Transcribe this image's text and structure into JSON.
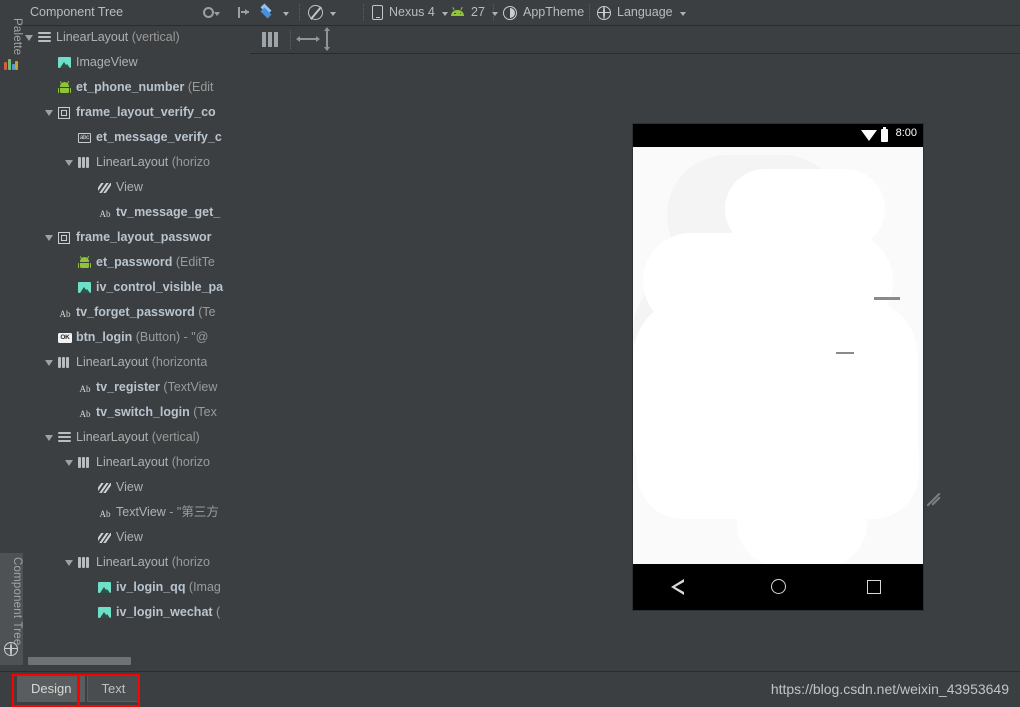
{
  "window": {
    "left_strip": {
      "palette_tab": "Palette",
      "component_tree_tab": "Component Tree"
    }
  },
  "tree_panel": {
    "title": "Component Tree",
    "header_buttons": [
      {
        "name": "gear-icon",
        "label": "Settings"
      },
      {
        "name": "collapse-icon",
        "label": "Hide"
      }
    ],
    "nodes": [
      {
        "indent": 0,
        "twisty": true,
        "icon": "linearlayout-vertical-icon",
        "name": "LinearLayout",
        "type": " (vertical)",
        "bold": false
      },
      {
        "indent": 1,
        "twisty": false,
        "icon": "imageview-icon",
        "name": "ImageView",
        "type": "",
        "bold": false
      },
      {
        "indent": 1,
        "twisty": false,
        "icon": "android-widget-icon",
        "name": "et_phone_number",
        "type": " (Edit",
        "bold": true
      },
      {
        "indent": 1,
        "twisty": true,
        "icon": "framelayout-icon",
        "name": "frame_layout_verify_co",
        "type": "",
        "bold": true
      },
      {
        "indent": 2,
        "twisty": false,
        "icon": "abc-textfield-icon",
        "name": "et_message_verify_c",
        "type": "",
        "bold": true
      },
      {
        "indent": 2,
        "twisty": true,
        "icon": "linearlayout-horizontal-icon",
        "name": "LinearLayout",
        "type": " (horizo",
        "bold": false
      },
      {
        "indent": 3,
        "twisty": false,
        "icon": "view-icon",
        "name": "View",
        "type": "",
        "bold": false
      },
      {
        "indent": 3,
        "twisty": false,
        "icon": "ab-textview-icon",
        "name": "tv_message_get_",
        "type": "",
        "bold": true
      },
      {
        "indent": 1,
        "twisty": true,
        "icon": "framelayout-icon",
        "name": "frame_layout_passwor",
        "type": "",
        "bold": true
      },
      {
        "indent": 2,
        "twisty": false,
        "icon": "android-widget-icon",
        "name": "et_password",
        "type": " (EditTe",
        "bold": true
      },
      {
        "indent": 2,
        "twisty": false,
        "icon": "imageview-icon",
        "name": "iv_control_visible_pa",
        "type": "",
        "bold": true
      },
      {
        "indent": 1,
        "twisty": false,
        "icon": "ab-textview-icon",
        "name": "tv_forget_password",
        "type": " (Te",
        "bold": true
      },
      {
        "indent": 1,
        "twisty": false,
        "icon": "button-ok-icon",
        "name": "btn_login",
        "type": " (Button) - \"@",
        "bold": true
      },
      {
        "indent": 1,
        "twisty": true,
        "icon": "linearlayout-horizontal-icon",
        "name": "LinearLayout",
        "type": " (horizonta",
        "bold": false
      },
      {
        "indent": 2,
        "twisty": false,
        "icon": "ab-textview-icon",
        "name": "tv_register",
        "type": " (TextView",
        "bold": true
      },
      {
        "indent": 2,
        "twisty": false,
        "icon": "ab-textview-icon",
        "name": "tv_switch_login",
        "type": " (Tex",
        "bold": true
      },
      {
        "indent": 1,
        "twisty": true,
        "icon": "linearlayout-vertical-icon",
        "name": "LinearLayout",
        "type": " (vertical)",
        "bold": false
      },
      {
        "indent": 2,
        "twisty": true,
        "icon": "linearlayout-horizontal-icon",
        "name": "LinearLayout",
        "type": " (horizo",
        "bold": false
      },
      {
        "indent": 3,
        "twisty": false,
        "icon": "view-icon",
        "name": "View",
        "type": "",
        "bold": false
      },
      {
        "indent": 3,
        "twisty": false,
        "icon": "ab-textview-icon",
        "name": "TextView",
        "type": " - \"第三方",
        "bold": false
      },
      {
        "indent": 3,
        "twisty": false,
        "icon": "view-icon",
        "name": "View",
        "type": "",
        "bold": false
      },
      {
        "indent": 2,
        "twisty": true,
        "icon": "linearlayout-horizontal-icon",
        "name": "LinearLayout",
        "type": " (horizo",
        "bold": false
      },
      {
        "indent": 3,
        "twisty": false,
        "icon": "imageview-icon",
        "name": "iv_login_qq",
        "type": " (Imag",
        "bold": true
      },
      {
        "indent": 3,
        "twisty": false,
        "icon": "imageview-icon",
        "name": "iv_login_wechat",
        "type": " (",
        "bold": true
      }
    ]
  },
  "toolbar": {
    "items": [
      {
        "name": "layers-dropdown",
        "label": "",
        "icon": "layers-icon",
        "caret": true
      },
      {
        "name": "orientation-dropdown",
        "label": "",
        "icon": "circle-slash-icon",
        "caret": true
      },
      {
        "name": "device-dropdown",
        "label": "Nexus 4",
        "icon": "phone-icon",
        "caret": true
      },
      {
        "name": "api-dropdown",
        "label": "27",
        "icon": "android-head-icon",
        "caret": true
      },
      {
        "name": "theme-dropdown",
        "label": "AppTheme",
        "icon": "theme-icon",
        "caret": false
      },
      {
        "name": "language-dropdown",
        "label": "Language",
        "icon": "globe-icon",
        "caret": true
      }
    ]
  },
  "surface_toolbar": {
    "items": [
      {
        "name": "columns-icon",
        "label": ""
      },
      {
        "name": "horizontal-resize-icon",
        "label": ""
      },
      {
        "name": "vertical-resize-icon",
        "label": ""
      }
    ]
  },
  "preview": {
    "status_bar": {
      "time": "8:00",
      "wifi_icon": "wifi-icon",
      "battery_icon": "battery-icon"
    },
    "nav_bar": {
      "back": "back-triangle-icon",
      "home": "home-circle-icon",
      "recents": "recents-square-icon"
    },
    "background_color": "#fafafa"
  },
  "bottom": {
    "tabs": [
      {
        "name": "design-tab",
        "label": "Design",
        "active": true
      },
      {
        "name": "text-tab",
        "label": "Text",
        "active": false
      }
    ],
    "watermark": "https://blog.csdn.net/weixin_43953649",
    "highlight_color": "#ff0000"
  }
}
